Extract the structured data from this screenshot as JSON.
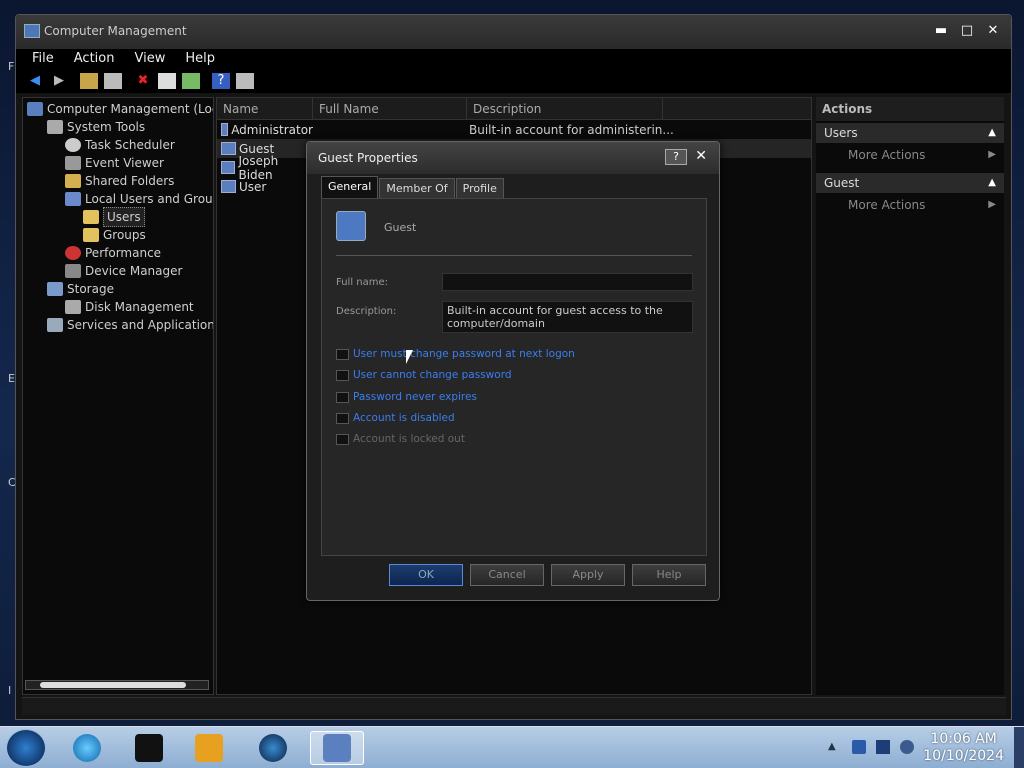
{
  "window": {
    "title": "Computer Management",
    "menu": [
      "File",
      "Action",
      "View",
      "Help"
    ]
  },
  "tree": {
    "items": [
      {
        "label": "Computer Management (Local",
        "indent": 0
      },
      {
        "label": "System Tools",
        "indent": 1
      },
      {
        "label": "Task Scheduler",
        "indent": 2
      },
      {
        "label": "Event Viewer",
        "indent": 2
      },
      {
        "label": "Shared Folders",
        "indent": 2
      },
      {
        "label": "Local Users and Groups",
        "indent": 2
      },
      {
        "label": "Users",
        "indent": 3
      },
      {
        "label": "Groups",
        "indent": 3
      },
      {
        "label": "Performance",
        "indent": 2
      },
      {
        "label": "Device Manager",
        "indent": 2
      },
      {
        "label": "Storage",
        "indent": 1
      },
      {
        "label": "Disk Management",
        "indent": 2
      },
      {
        "label": "Services and Applications",
        "indent": 1
      }
    ]
  },
  "list": {
    "columns": [
      "Name",
      "Full Name",
      "Description"
    ],
    "rows": [
      {
        "name": "Administrator",
        "full": "",
        "desc": "Built-in account for administerin..."
      },
      {
        "name": "Guest",
        "full": "",
        "desc": ""
      },
      {
        "name": "Joseph Biden",
        "full": "",
        "desc": ""
      },
      {
        "name": "User",
        "full": "",
        "desc": ""
      }
    ]
  },
  "actions": {
    "title": "Actions",
    "groups": [
      {
        "header": "Users",
        "item": "More Actions"
      },
      {
        "header": "Guest",
        "item": "More Actions"
      }
    ]
  },
  "dialog": {
    "title": "Guest Properties",
    "help": "?",
    "tabs": [
      "General",
      "Member Of",
      "Profile"
    ],
    "username": "Guest",
    "full_name_label": "Full name:",
    "full_name_value": "",
    "description_label": "Description:",
    "description_value": "Built-in account for guest access to the computer/domain",
    "checks": [
      "User must change password at next logon",
      "User cannot change password",
      "Password never expires",
      "Account is disabled",
      "Account is locked out"
    ],
    "buttons": [
      "OK",
      "Cancel",
      "Apply",
      "Help"
    ]
  },
  "taskbar": {
    "time": "10:06 AM",
    "date": "10/10/2024"
  },
  "colors": {
    "link": "#3a7ef0",
    "taskbar": "#8eaed2"
  }
}
